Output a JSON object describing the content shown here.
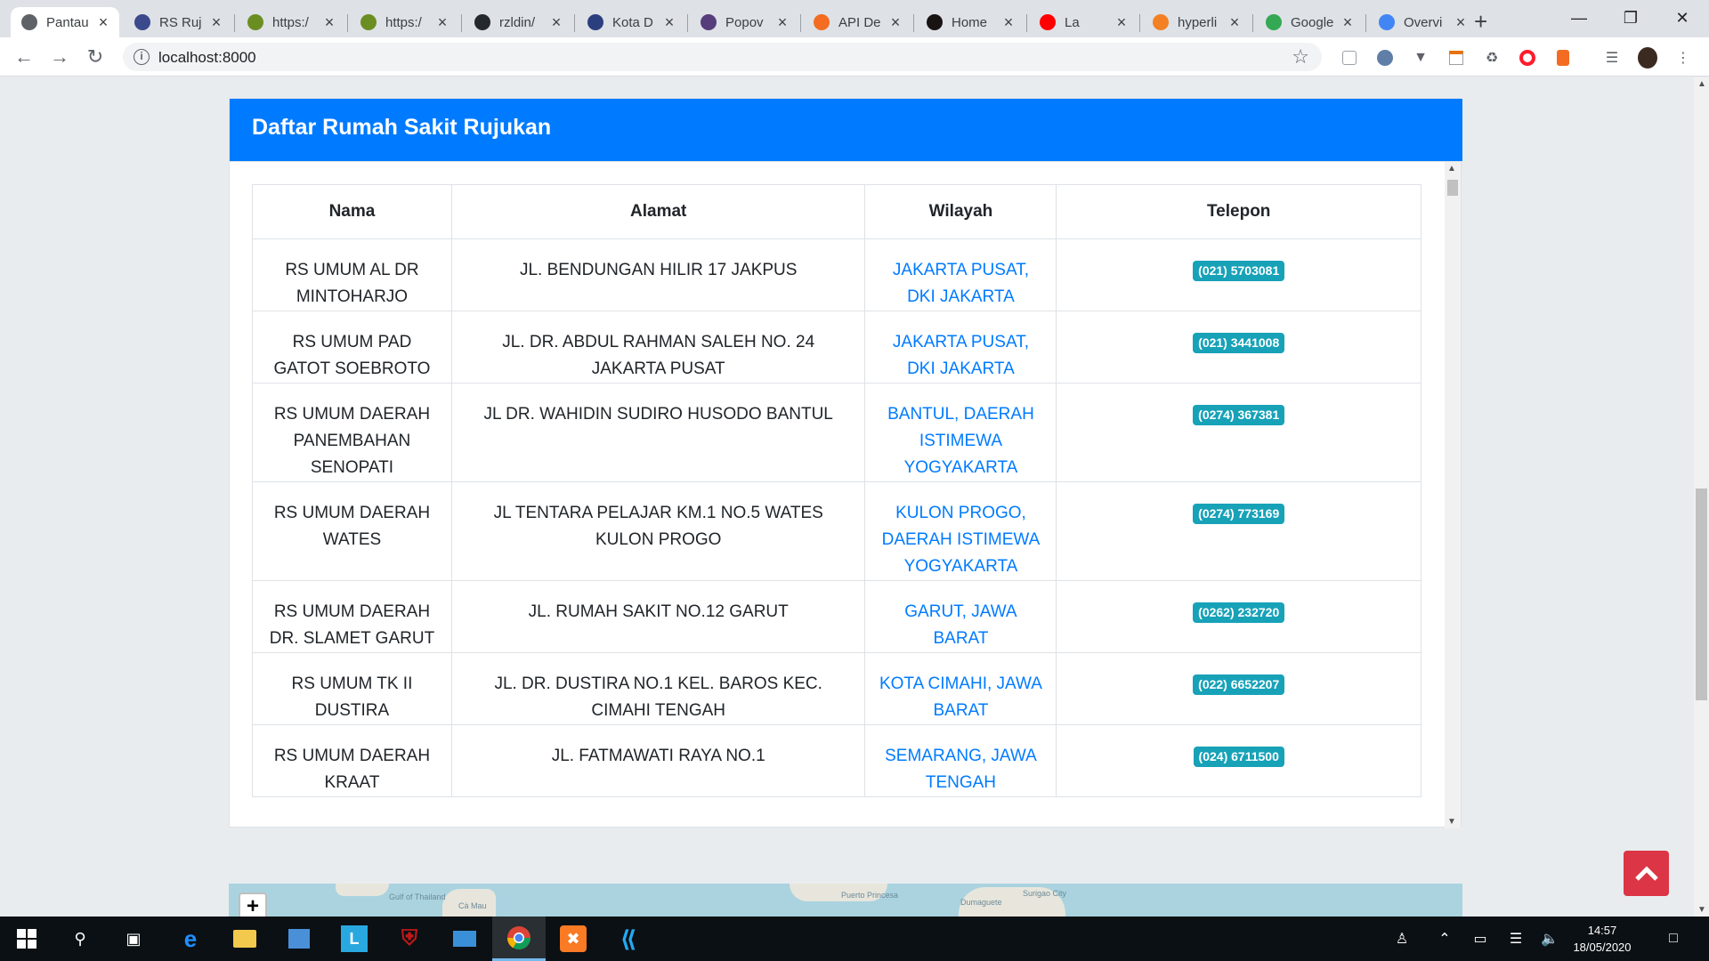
{
  "browser": {
    "tabs": [
      {
        "title": "Pantau",
        "icon": "globe-icon",
        "color": "#5f6368",
        "active": true
      },
      {
        "title": "RS Ruj",
        "icon": "ministry-logo-icon",
        "color": "#3b4a8c"
      },
      {
        "title": "https:/",
        "icon": "stack-icon",
        "color": "#6b8e23"
      },
      {
        "title": "https:/",
        "icon": "stack-icon",
        "color": "#6b8e23"
      },
      {
        "title": "rzldin/",
        "icon": "github-icon",
        "color": "#24292e"
      },
      {
        "title": "Kota D",
        "icon": "shield-logo-icon",
        "color": "#2b3f7f"
      },
      {
        "title": "Popov",
        "icon": "bootstrap-icon",
        "color": "#563d7c"
      },
      {
        "title": "API De",
        "icon": "bolt-icon",
        "color": "#f36c21"
      },
      {
        "title": "Home",
        "icon": "spotify-icon",
        "color": "#191414"
      },
      {
        "title": "La",
        "icon": "youtube-icon",
        "color": "#ff0000"
      },
      {
        "title": "hyperli",
        "icon": "stackoverflow-icon",
        "color": "#f48024"
      },
      {
        "title": "Google",
        "icon": "maps-pin-icon",
        "color": "#34a853"
      },
      {
        "title": "Overvi",
        "icon": "code-icon",
        "color": "#4285f4"
      }
    ],
    "new_tab": "+",
    "url": "localhost:8000",
    "extensions": [
      "pocket-icon",
      "compass-icon",
      "vee-icon",
      "calendar-icon",
      "recycle-icon",
      "opera-icon",
      "avast-icon",
      "media-queue-icon",
      "profile-avatar-icon",
      "kebab-menu-icon"
    ]
  },
  "card": {
    "title": "Daftar Rumah Sakit Rujukan",
    "columns": [
      "Nama",
      "Alamat",
      "Wilayah",
      "Telepon"
    ],
    "rows": [
      {
        "nama": "RS UMUM AL DR MINTOHARJO",
        "alamat": "JL. BENDUNGAN HILIR 17 JAKPUS",
        "wilayah": "JAKARTA PUSAT, DKI JAKARTA",
        "telepon": "(021) 5703081"
      },
      {
        "nama": "RS UMUM PAD GATOT SOEBROTO",
        "alamat": "JL. DR. ABDUL RAHMAN SALEH NO. 24 JAKARTA PUSAT",
        "wilayah": "JAKARTA PUSAT, DKI JAKARTA",
        "telepon": "(021) 3441008"
      },
      {
        "nama": "RS UMUM DAERAH PANEMBAHAN SENOPATI",
        "alamat": "JL DR. WAHIDIN SUDIRO HUSODO BANTUL",
        "wilayah": "BANTUL, DAERAH ISTIMEWA YOGYAKARTA",
        "telepon": "(0274) 367381"
      },
      {
        "nama": "RS UMUM DAERAH WATES",
        "alamat": "JL TENTARA PELAJAR KM.1 NO.5 WATES KULON PROGO",
        "wilayah": "KULON PROGO, DAERAH ISTIMEWA YOGYAKARTA",
        "telepon": "(0274) 773169"
      },
      {
        "nama": "RS UMUM DAERAH DR. SLAMET GARUT",
        "alamat": "JL. RUMAH SAKIT NO.12 GARUT",
        "wilayah": "GARUT, JAWA BARAT",
        "telepon": "(0262) 232720"
      },
      {
        "nama": "RS UMUM TK II DUSTIRA",
        "alamat": "JL. DR. DUSTIRA NO.1 KEL. BAROS KEC. CIMAHI TENGAH",
        "wilayah": "KOTA CIMAHI, JAWA BARAT",
        "telepon": "(022) 6652207"
      },
      {
        "nama": "RS UMUM DAERAH KRAAT",
        "alamat": "JL. FATMAWATI RAYA NO.1",
        "wilayah": "SEMARANG, JAWA TENGAH",
        "telepon": "(024) 6711500"
      }
    ]
  },
  "map": {
    "zoom_in": "+",
    "labels": [
      "Gulf of Thailand",
      "Cà Mau",
      "Puerto Princesa",
      "Dumaguete",
      "Surigao City"
    ]
  },
  "taskbar": {
    "time": "14:57",
    "date": "18/05/2020"
  },
  "colors": {
    "primary": "#007bff",
    "info": "#17a2b8",
    "danger": "#dc3545"
  }
}
